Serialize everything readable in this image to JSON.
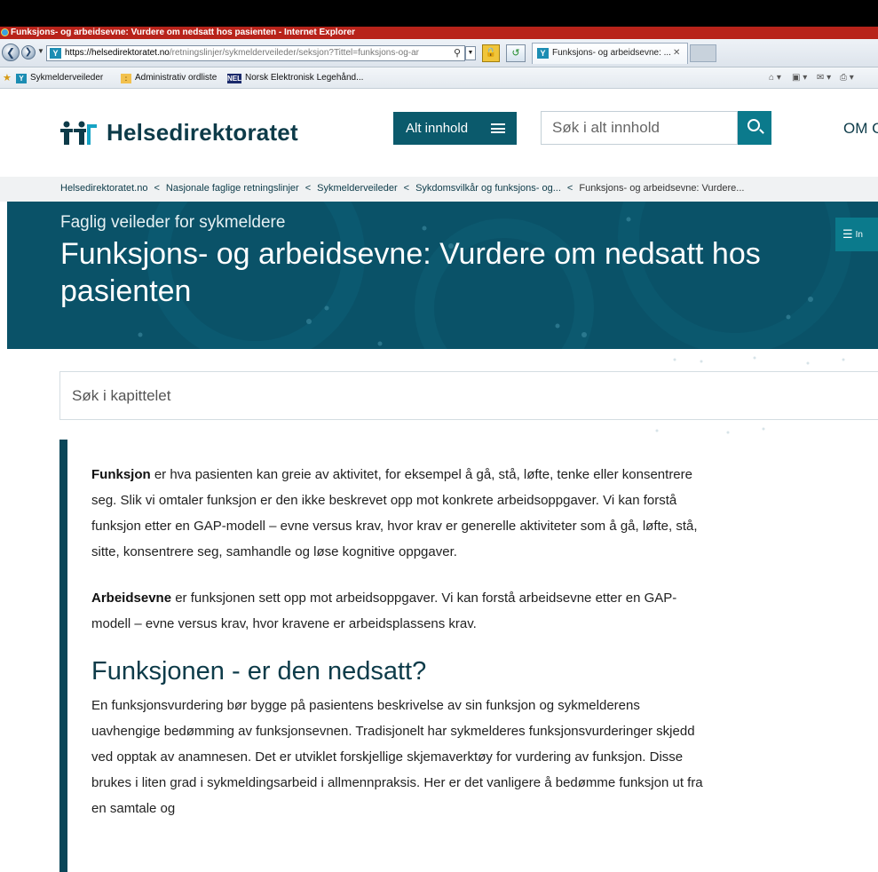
{
  "browser": {
    "window_title": "Funksjons- og arbeidsevne: Vurdere om nedsatt hos pasienten - Internet Explorer",
    "address": {
      "host": "https://helsedirektoratet.no",
      "path": "/retningslinjer/sykmelderveileder/seksjon?Tittel=funksjons-og-ar"
    },
    "tab_title": "Funksjons- og arbeidsevne: ...",
    "favorites": [
      {
        "label": "Sykmelderveileder"
      },
      {
        "label": "Administrativ ordliste"
      },
      {
        "label": "Norsk Elektronisk Legehånd..."
      }
    ]
  },
  "site": {
    "logo_text": "Helsedirektoratet",
    "menu_button": "Alt innhold",
    "search_placeholder": "Søk i alt innhold",
    "om_link": "OM C"
  },
  "breadcrumb": [
    "Helsedirektoratet.no",
    "Nasjonale faglige retningslinjer",
    "Sykmelderveileder",
    "Sykdomsvilkår og funksjons- og...",
    "Funksjons- og arbeidsevne: Vurdere..."
  ],
  "hero": {
    "subtitle": "Faglig veileder for sykmeldere",
    "title": "Funksjons- og arbeidsevne: Vurdere om nedsatt hos pasienten",
    "toc_label": "In"
  },
  "chapter_search_placeholder": "Søk i kapittelet",
  "content": {
    "p1_term": "Funksjon",
    "p1_text": " er hva pasienten kan greie av aktivitet, for eksempel å gå, stå, løfte, tenke eller konsentrere seg. Slik vi omtaler funksjon er den ikke beskrevet opp mot konkrete arbeidsoppgaver. Vi kan forstå funksjon etter en GAP-modell – evne versus krav, hvor krav er generelle aktiviteter som å gå, løfte, stå, sitte, konsentrere seg, samhandle og løse kognitive oppgaver.",
    "p2_term": "Arbeidsevne",
    "p2_text": " er funksjonen sett opp mot arbeidsoppgaver. Vi kan forstå arbeidsevne etter en GAP-modell – evne versus krav, hvor kravene er arbeidsplassens krav.",
    "section_heading": "Funksjonen - er den nedsatt?",
    "p3_text": "En funksjonsvurdering bør bygge på pasientens beskrivelse av sin funksjon og sykmelderens uavhengige bedømming av funksjonsevnen. Tradisjonelt har sykmelderes funksjonsvurderinger skjedd ved opptak av anamnesen. Det er utviklet forskjellige skjemaverktøy for vurdering av funksjon. Disse brukes i liten grad i sykmeldingsarbeid i allmennpraksis. Her er det vanligere å bedømme funksjon ut fra en samtale og"
  },
  "colors": {
    "brand_dark": "#0d3b49",
    "hero_bg": "#0a5268",
    "button_teal": "#0b7a8c",
    "titlebar_red": "#b8231a"
  }
}
